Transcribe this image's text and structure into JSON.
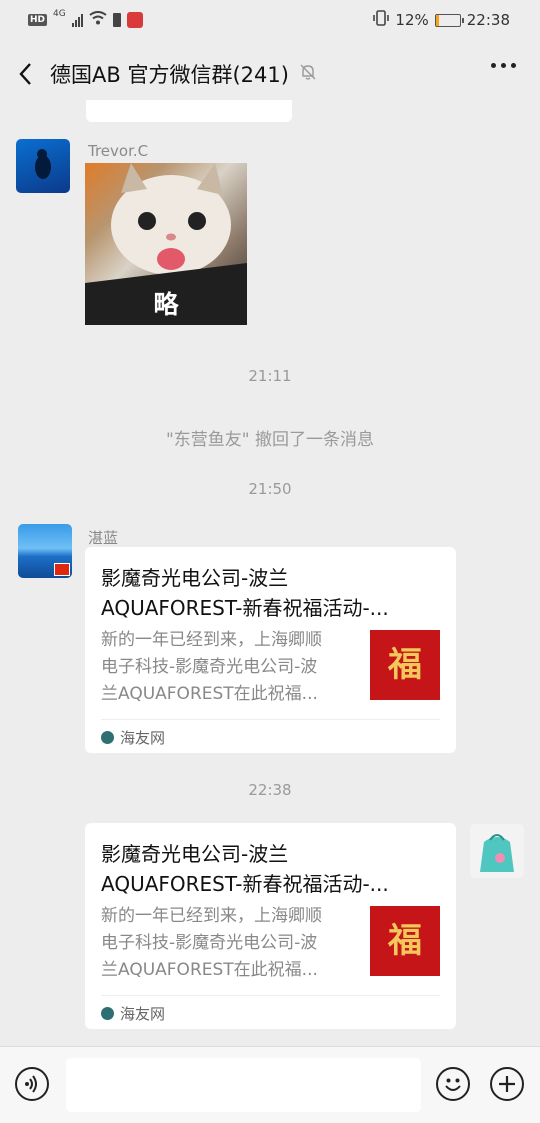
{
  "status_bar": {
    "hd": "HD",
    "network": "4G",
    "battery_pct": "12%",
    "battery_level": 0.12,
    "time": "22:38"
  },
  "header": {
    "title": "德国AB  官方微信群(241)",
    "back_icon": "chevron-left-icon",
    "mute_icon": "bell-off-icon",
    "more_icon": "more-horizontal-icon"
  },
  "messages": [
    {
      "type": "partial_bubble",
      "text": ""
    },
    {
      "type": "sticker",
      "sender": "Trevor.C",
      "caption": "略"
    },
    {
      "type": "timestamp",
      "text": "21:11"
    },
    {
      "type": "system",
      "text": "\"东营鱼友\" 撤回了一条消息"
    },
    {
      "type": "timestamp",
      "text": "21:50"
    },
    {
      "type": "link_card",
      "sender": "湛蓝",
      "title_line1": "影魔奇光电公司-波兰",
      "title_line2": "AQUAFOREST-新春祝福活动-...",
      "desc_line1": "新的一年已经到来，上海卿顺",
      "desc_line2": "电子科技-影魔奇光电公司-波",
      "desc_line3": "兰AQUAFOREST在此祝福...",
      "thumb_glyph": "福",
      "source": "海友网"
    },
    {
      "type": "timestamp",
      "text": "22:38"
    },
    {
      "type": "link_card_self",
      "title_line1": "影魔奇光电公司-波兰",
      "title_line2": "AQUAFOREST-新春祝福活动-...",
      "desc_line1": "新的一年已经到来，上海卿顺",
      "desc_line2": "电子科技-影魔奇光电公司-波",
      "desc_line3": "兰AQUAFOREST在此祝福...",
      "thumb_glyph": "福",
      "source": "海友网"
    }
  ],
  "footer": {
    "voice_icon": "voice-icon",
    "emoji_icon": "smiley-icon",
    "add_icon": "plus-circle-icon"
  },
  "colors": {
    "background": "#ededed",
    "bubble": "#ffffff",
    "thumb_red": "#c61518"
  }
}
